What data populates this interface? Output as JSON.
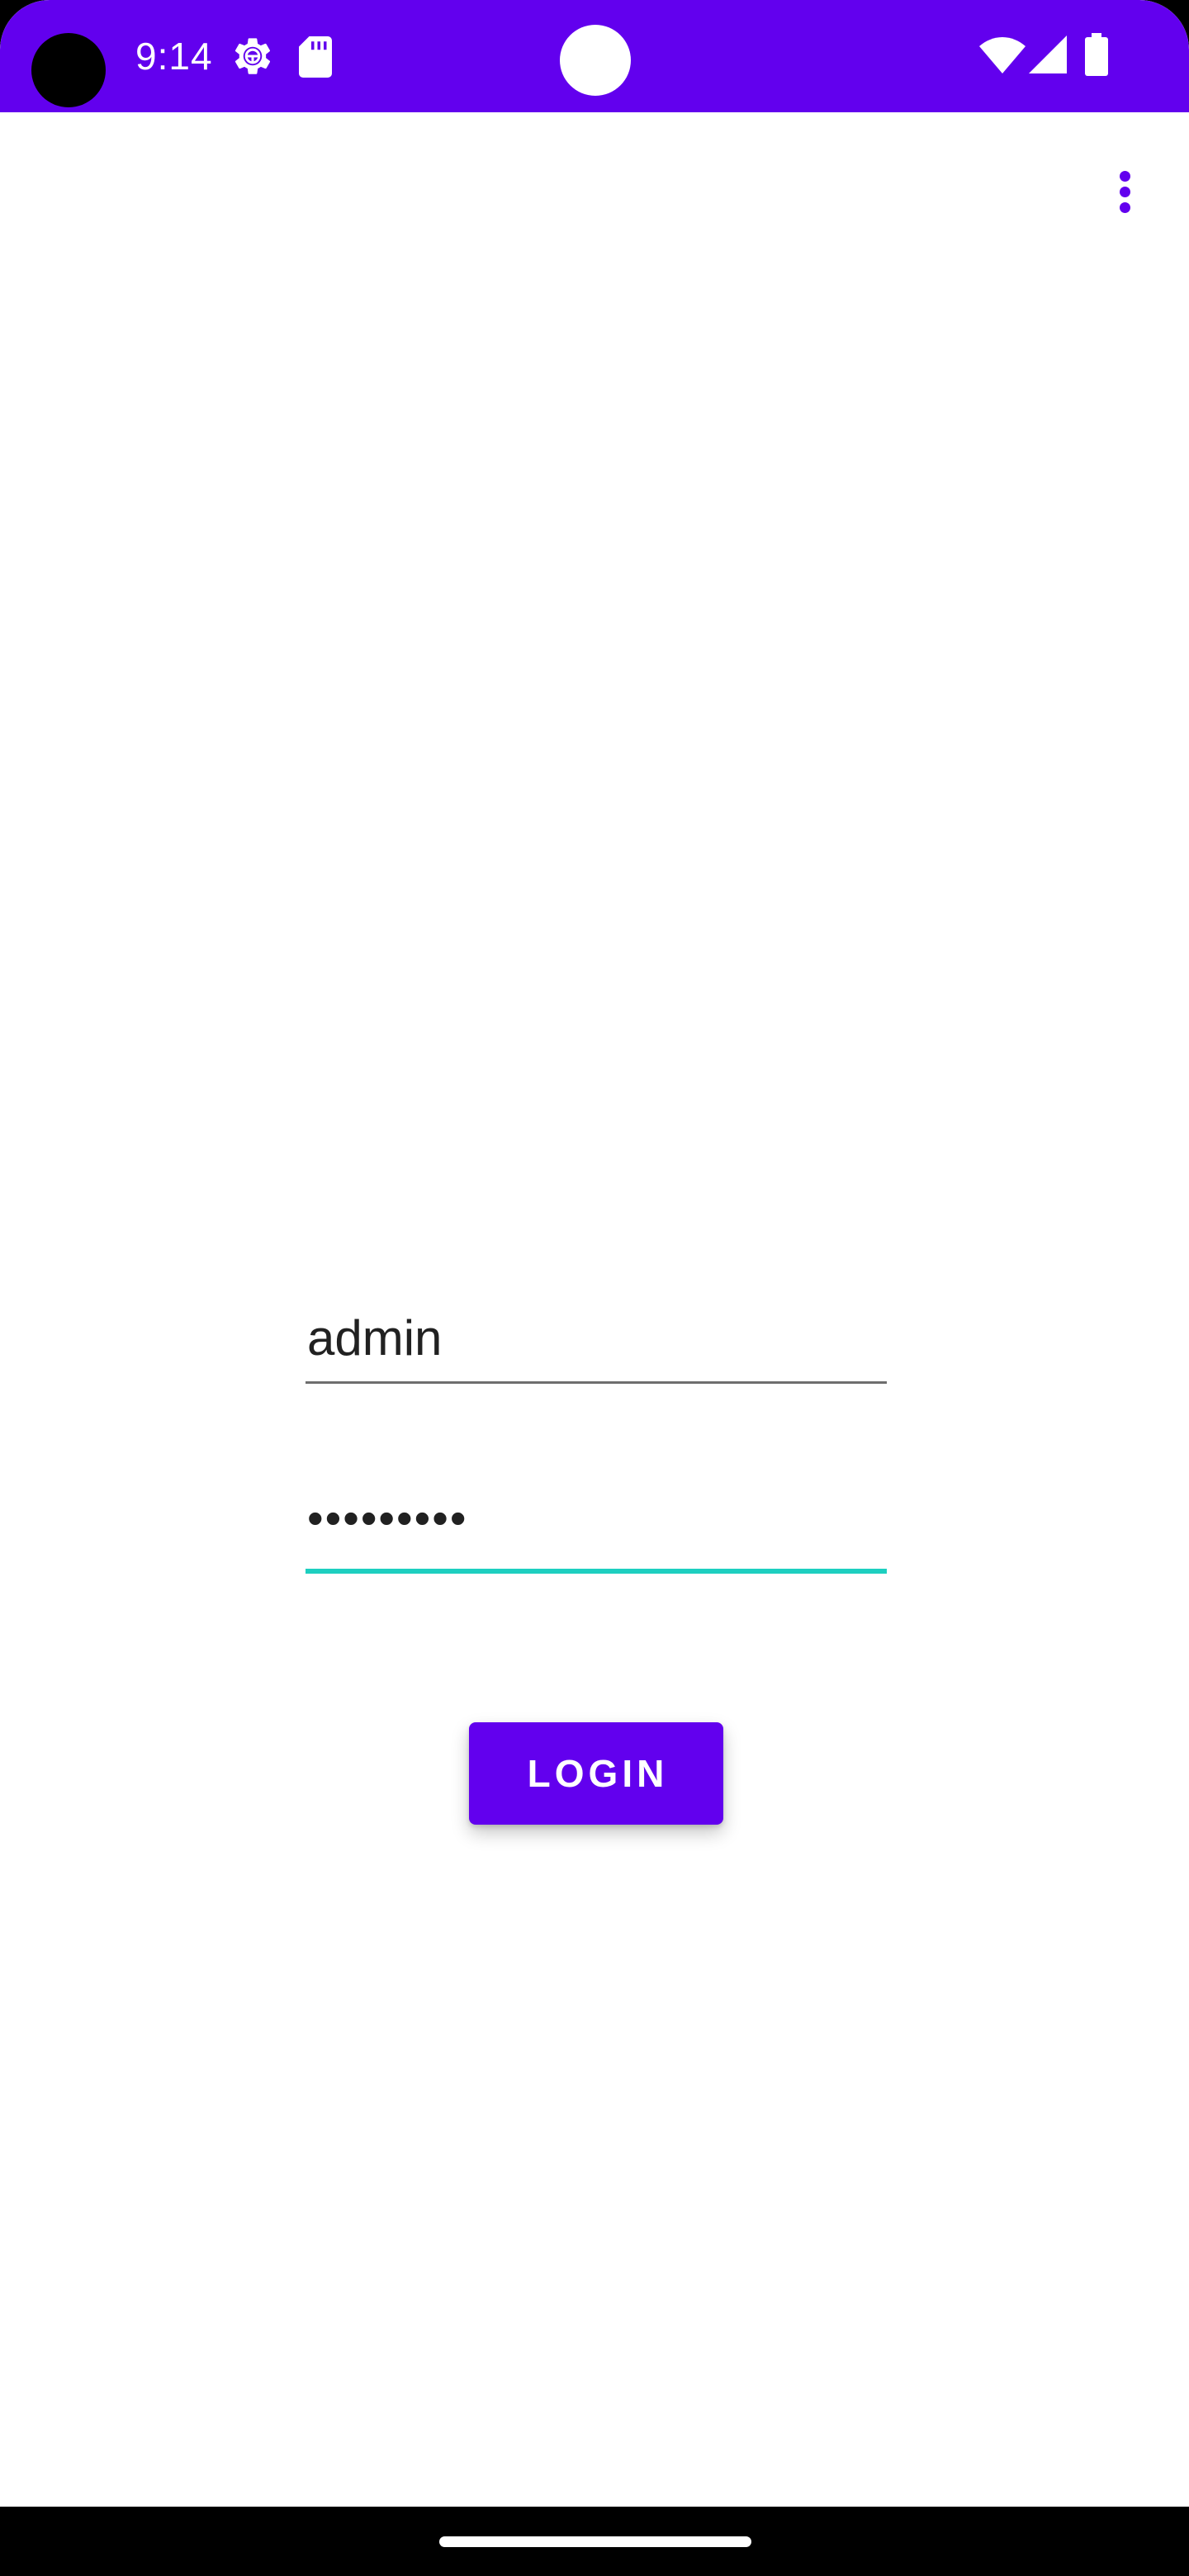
{
  "status_bar": {
    "time": "9:14",
    "icons": [
      "camera-cutout",
      "gear-icon",
      "sd-card-icon",
      "wifi-icon",
      "cell-signal-icon",
      "battery-icon"
    ],
    "background_color": "#6200ee"
  },
  "toolbar": {
    "overflow_icon": "more-vert-icon"
  },
  "login_form": {
    "username_value": "admin",
    "password_value": "•••••••••",
    "login_label": "LOGIN"
  },
  "colors": {
    "primary": "#6200ee",
    "focused_underline": "#1dcfc0",
    "text": "#212121"
  }
}
